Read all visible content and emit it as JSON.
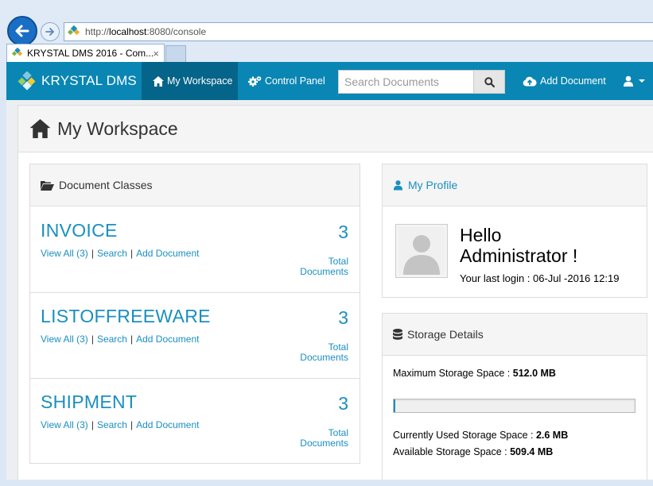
{
  "browser": {
    "url_prefix": "http://",
    "url_host": "localhost",
    "url_rest": ":8080/console",
    "tab_title": "KRYSTAL DMS 2016 - Com...",
    "tab_close": "×"
  },
  "appnav": {
    "brand": "KRYSTAL DMS",
    "my_workspace": "My Workspace",
    "control_panel": "Control Panel",
    "search_placeholder": "Search Documents",
    "add_document": "Add Document",
    "colors": {
      "bar": "#0a86b4",
      "active": "#046489"
    }
  },
  "page": {
    "title": "My Workspace"
  },
  "document_classes": {
    "heading": "Document Classes",
    "items": [
      {
        "name": "INVOICE",
        "count": "3",
        "view_all": "View All (3)",
        "search": "Search",
        "add": "Add Document",
        "total_line1": "Total",
        "total_line2": "Documents"
      },
      {
        "name": "LISTOFFREEWARE",
        "count": "3",
        "view_all": "View All (3)",
        "search": "Search",
        "add": "Add Document",
        "total_line1": "Total",
        "total_line2": "Documents"
      },
      {
        "name": "SHIPMENT",
        "count": "3",
        "view_all": "View All (3)",
        "search": "Search",
        "add": "Add Document",
        "total_line1": "Total",
        "total_line2": "Documents"
      }
    ],
    "separator": "|"
  },
  "profile": {
    "heading": "My Profile",
    "hello_line1": "Hello",
    "hello_line2": "Administrator !",
    "last_login": "Your last login : 06-Jul -2016 12:19"
  },
  "storage": {
    "heading": "Storage Details",
    "max_label": "Maximum Storage Space : ",
    "max_value": "512.0 MB",
    "used_label": "Currently Used Storage Space : ",
    "used_value": "2.6 MB",
    "available_label": "Available Storage Space : ",
    "available_value": "509.4 MB",
    "used_fraction": 0.005
  }
}
